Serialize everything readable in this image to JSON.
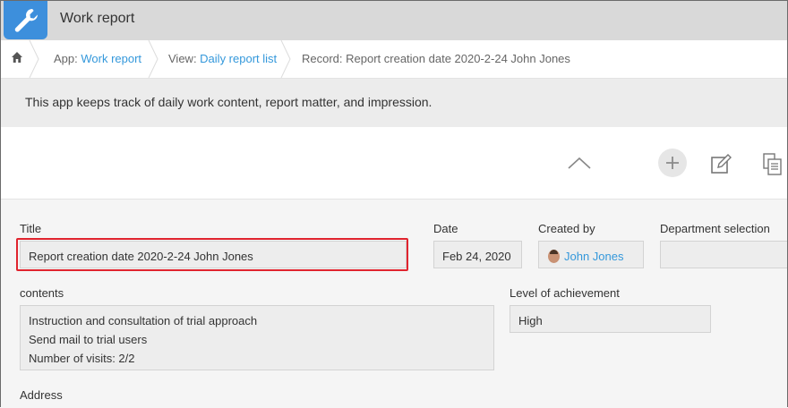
{
  "header": {
    "app_icon": "wrench-icon",
    "title": "Work report"
  },
  "breadcrumb": {
    "home_icon": "home-icon",
    "app_prefix": "App: ",
    "app_link": "Work report",
    "view_prefix": "View: ",
    "view_link": "Daily report list",
    "record": "Record: Report creation date 2020-2-24 John Jones"
  },
  "description": "This app keeps track of daily work content, report matter, and impression.",
  "toolbar": {
    "collapse_icon": "chevron-up-icon",
    "add_icon": "plus-icon",
    "edit_icon": "edit-icon",
    "duplicate_icon": "duplicate-icon"
  },
  "fields": {
    "title": {
      "label": "Title",
      "value": "Report creation date 2020-2-24 John Jones"
    },
    "date": {
      "label": "Date",
      "value": "Feb 24, 2020"
    },
    "created_by": {
      "label": "Created by",
      "value": "John Jones"
    },
    "department": {
      "label": "Department selection",
      "value": ""
    },
    "contents": {
      "label": "contents",
      "lines": [
        "Instruction and consultation of trial approach",
        "Send mail to trial users",
        "Number of visits: 2/2"
      ]
    },
    "achievement": {
      "label": "Level of achievement",
      "value": "High"
    },
    "address": {
      "label": "Address"
    }
  },
  "colors": {
    "accent": "#3d8fdc",
    "link": "#3498db",
    "highlight": "#e0242e"
  }
}
